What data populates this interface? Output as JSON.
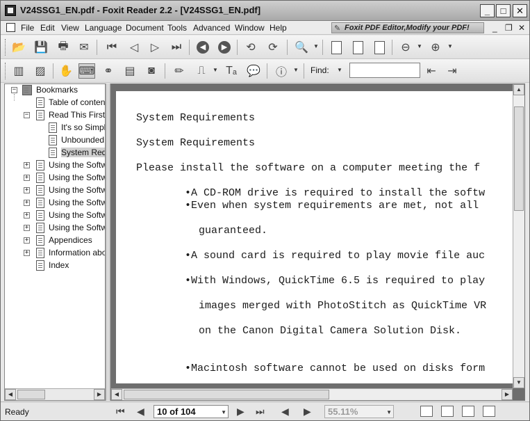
{
  "window": {
    "title": "V24SSG1_EN.pdf - Foxit Reader 2.2 - [V24SSG1_EN.pdf]",
    "minimize": "_",
    "maximize": "□",
    "close": "✕"
  },
  "menu": {
    "items": [
      "File",
      "Edit",
      "View",
      "Language",
      "Document",
      "Tools",
      "Advanced",
      "Window",
      "Help"
    ],
    "promo": "Foxit PDF Editor,Modify your PDF!",
    "mdi_minimize": "_",
    "mdi_restore": "❐",
    "mdi_close": "✕"
  },
  "toolbar": {
    "find_label": "Find:",
    "find_value": ""
  },
  "bookmarks": {
    "root": "Bookmarks",
    "items": [
      {
        "label": "Table of contents",
        "level": 1,
        "expander": ""
      },
      {
        "label": "Read This First",
        "level": 1,
        "expander": "−"
      },
      {
        "label": "It's so Simple",
        "level": 2,
        "expander": ""
      },
      {
        "label": "Unbounded",
        "level": 2,
        "expander": ""
      },
      {
        "label": "System Requirements",
        "level": 2,
        "expander": "",
        "selected": true
      },
      {
        "label": "Using the Software",
        "level": 1,
        "expander": "+"
      },
      {
        "label": "Using the Software",
        "level": 1,
        "expander": "+"
      },
      {
        "label": "Using the Software",
        "level": 1,
        "expander": "+"
      },
      {
        "label": "Using the Software",
        "level": 1,
        "expander": "+"
      },
      {
        "label": "Using the Software",
        "level": 1,
        "expander": "+"
      },
      {
        "label": "Using the Software",
        "level": 1,
        "expander": "+"
      },
      {
        "label": "Appendices",
        "level": 1,
        "expander": "+"
      },
      {
        "label": "Information about",
        "level": 1,
        "expander": "+"
      },
      {
        "label": "Index",
        "level": 1,
        "expander": ""
      }
    ]
  },
  "document": {
    "lines": [
      "System Requirements",
      "System Requirements",
      "Please install the software on a computer meeting the f",
      "•A CD-ROM drive is required to install the softw",
      "•Even when system requirements are met, not all",
      "guaranteed.",
      "•A sound card is required to play movie file auc",
      "•With Windows, QuickTime 6.5 is required to play",
      "images merged with PhotoStitch as QuickTime VR",
      "on the Canon Digital Camera Solution Disk.",
      "•Macintosh software cannot be used on disks form"
    ]
  },
  "status": {
    "text": "Ready",
    "page": "10 of 104",
    "zoom": "55.11%"
  }
}
